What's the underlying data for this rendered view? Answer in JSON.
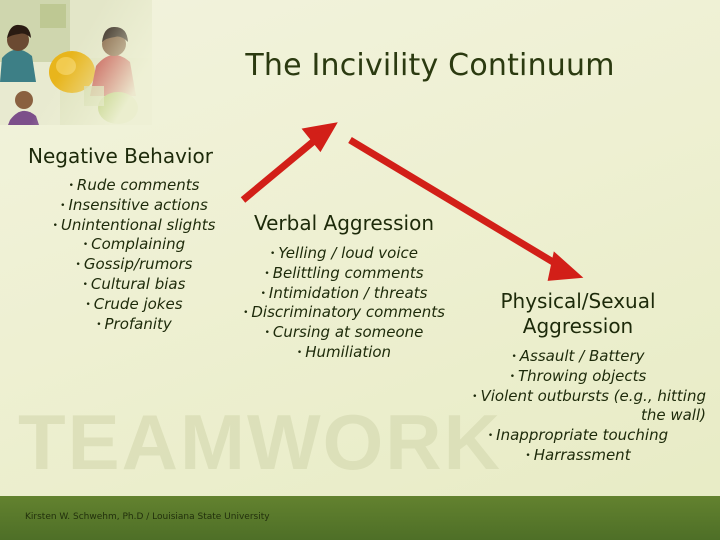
{
  "slide": {
    "title": "The Incivility Continuum",
    "watermark": "TEAMWORK",
    "footer": "Kirsten W. Schwehm, Ph.D / Louisiana State University",
    "accent_arrow_color": "#d21f18",
    "bar_color": "#5a7a2e",
    "background_color": "#eff1d6"
  },
  "columns": [
    {
      "heading": "Negative Behavior",
      "items": [
        "Rude comments",
        "Insensitive actions",
        "Unintentional slights",
        "Complaining",
        "Gossip/rumors",
        "Cultural bias",
        "Crude jokes",
        "Profanity"
      ]
    },
    {
      "heading": "Verbal  Aggression",
      "items": [
        "Yelling / loud voice",
        "Belittling comments",
        "Intimidation / threats",
        "Discriminatory comments",
        "Cursing at someone",
        "Humiliation"
      ]
    },
    {
      "heading": "Physical/Sexual Aggression",
      "items": [
        "Assault / Battery",
        "Throwing objects",
        "Violent outbursts          (e.g., hitting the wall)",
        "Inappropriate touching",
        "Harrassment"
      ]
    }
  ]
}
